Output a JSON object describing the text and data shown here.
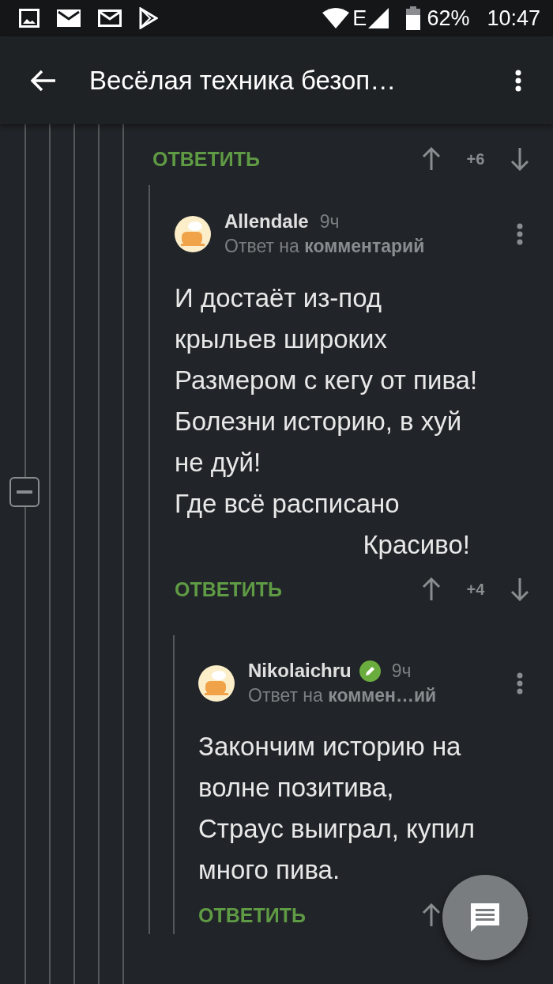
{
  "status_bar": {
    "battery": "62%",
    "time": "10:47",
    "network": "E"
  },
  "app_bar": {
    "title": "Весёлая техника безоп…"
  },
  "thread": {
    "collapse_expanded": true,
    "top_actions": {
      "reply": "ОТВЕТИТЬ",
      "score": "+6"
    },
    "comments": [
      {
        "author": "Allendale",
        "time": "9ч",
        "pencil_badge": false,
        "reply_prefix": "Ответ на",
        "reply_target": "комментарий",
        "body": "И достаёт из-под\nкрыльев широких\nРазмером с кегу от пива!\nБолезни историю, в хуй\nне дуй!\nГде всё расписано\n                          Красиво!",
        "reply": "ОТВЕТИТЬ",
        "score": "+4"
      },
      {
        "author": "Nikolaichru",
        "time": "9ч",
        "pencil_badge": true,
        "reply_prefix": "Ответ на",
        "reply_target": "коммен…ий",
        "body": "Закончим историю на\nволне позитива,\nСтраус выиграл, купил\nмного пива.",
        "reply": "ОТВЕТИТЬ"
      }
    ]
  }
}
